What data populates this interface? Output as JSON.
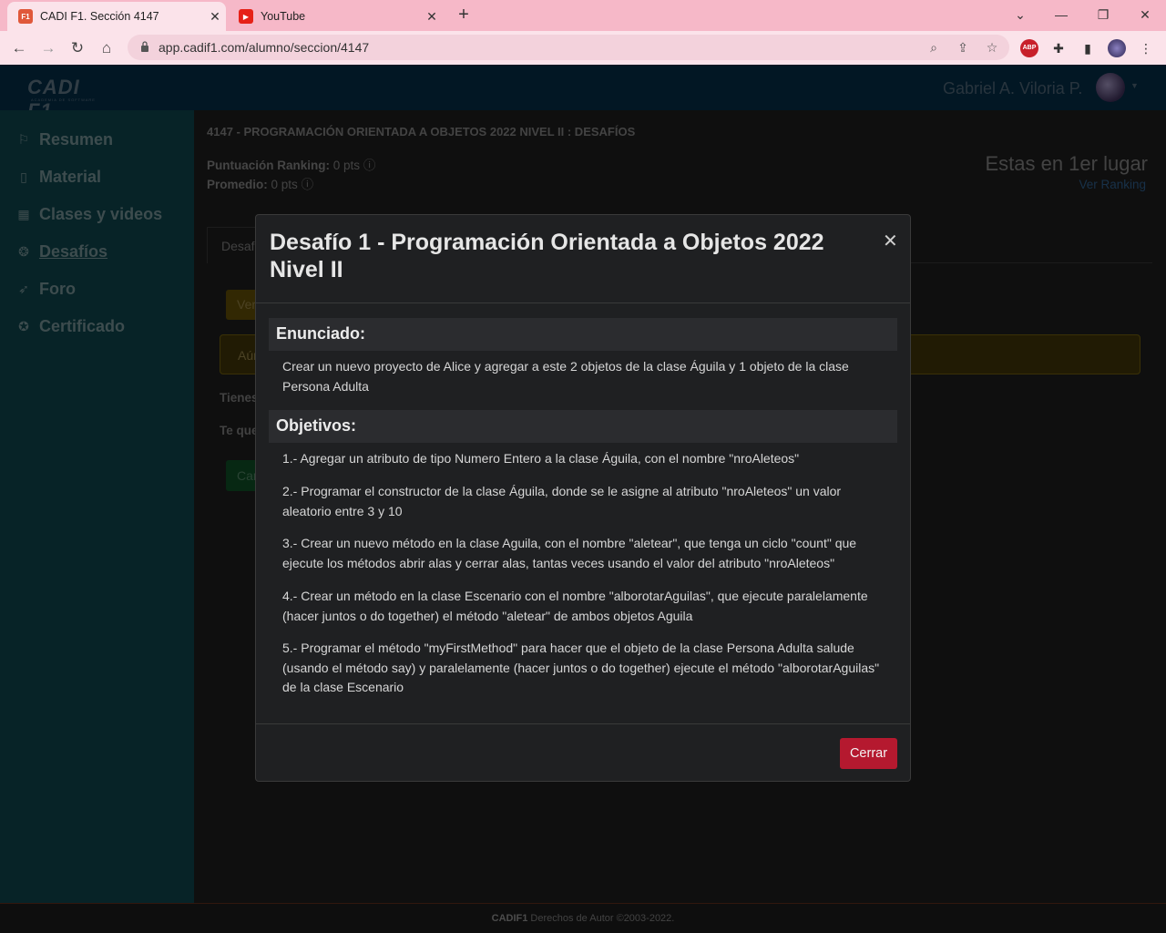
{
  "browser": {
    "tabs": [
      {
        "title": "CADI F1. Sección 4147",
        "favicon": "cadi-favicon",
        "active": true
      },
      {
        "title": "YouTube",
        "favicon": "youtube-favicon",
        "active": false
      }
    ],
    "url": "app.cadif1.com/alumno/seccion/4147"
  },
  "header": {
    "logo_text": "CADI F1",
    "logo_sub": "ACADEMIA DE SOFTWARE",
    "username": "Gabriel A. Viloria P."
  },
  "sidebar": {
    "items": [
      {
        "label": "Resumen",
        "icon": "flag-icon"
      },
      {
        "label": "Material",
        "icon": "book-icon"
      },
      {
        "label": "Clases y videos",
        "icon": "calendar-icon"
      },
      {
        "label": "Desafíos",
        "icon": "brain-icon"
      },
      {
        "label": "Foro",
        "icon": "paper-plane-icon"
      },
      {
        "label": "Certificado",
        "icon": "certificate-icon"
      }
    ],
    "active": "Desafíos"
  },
  "main": {
    "breadcrumb": "4147 - PROGRAMACIÓN ORIENTADA A OBJETOS 2022 NIVEL II : DESAFÍOS",
    "puntuacion_label": "Puntuación Ranking:",
    "puntuacion_value": "0 pts",
    "promedio_label": "Promedio:",
    "promedio_value": "0 pts",
    "place": "Estas en 1er lugar",
    "ver_ranking": "Ver Ranking",
    "tab_label": "Desafí",
    "ver_button": "Ver",
    "alert_text": "Aún",
    "tienes_text": "Tienes",
    "te_que_text": "Te que",
    "car_button": "Car"
  },
  "modal": {
    "title": "Desafío 1 - Programación Orientada a Objetos 2022 Nivel II",
    "enunciado_heading": "Enunciado:",
    "enunciado_text": "Crear un nuevo proyecto de Alice y agregar a este 2 objetos de la clase Águila y 1 objeto de la clase Persona Adulta",
    "objetivos_heading": "Objetivos:",
    "objetivos": [
      "1.- Agregar un atributo de tipo Numero Entero a la clase Águila, con el nombre \"nroAleteos\"",
      "2.- Programar el constructor de la clase Águila, donde se le asigne al atributo \"nroAleteos\" un valor aleatorio entre 3 y 10",
      "3.- Crear un nuevo método en la clase Aguila, con el nombre \"aletear\", que tenga un ciclo \"count\" que ejecute los métodos abrir alas y cerrar alas, tantas veces usando el valor del atributo \"nroAleteos\"",
      "4.- Crear un método en la clase Escenario con el nombre \"alborotarAguilas\", que ejecute paralelamente (hacer juntos o do together) el método \"aletear\" de ambos objetos Aguila",
      "5.- Programar el método \"myFirstMethod\" para hacer que el objeto de la clase Persona Adulta salude (usando el método say) y paralelamente (hacer juntos o do together) ejecute el método \"alborotarAguilas\" de la clase Escenario"
    ],
    "close_button": "Cerrar"
  },
  "footer": {
    "brand": "CADIF1",
    "text": "Derechos de Autor ©2003-2022."
  },
  "colors": {
    "header_bg": "#042a43",
    "sidebar_bg": "#0d4047",
    "close_button": "#b5192f",
    "tabbar_bg": "#f6b8c8"
  }
}
